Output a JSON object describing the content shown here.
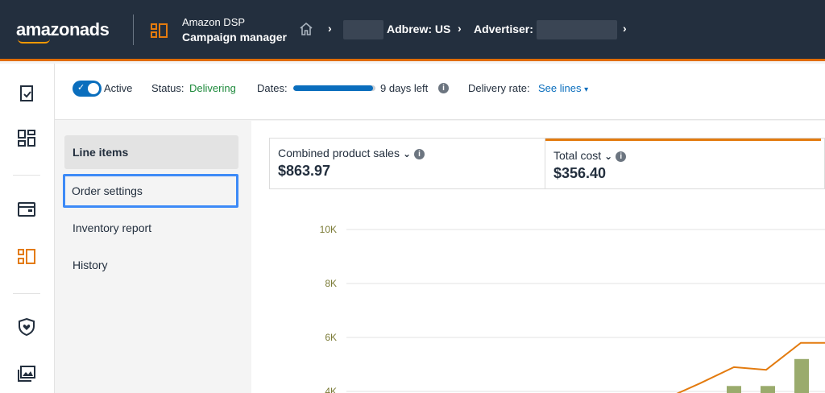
{
  "header": {
    "logo": "amazonads",
    "app_title": "Amazon DSP",
    "app_subtitle": "Campaign manager",
    "breadcrumb_account": "Adbrew: US",
    "breadcrumb_advertiser": "Advertiser:"
  },
  "status": {
    "active_label": "Active",
    "status_label": "Status:",
    "status_value": "Delivering",
    "dates_label": "Dates:",
    "dates_progress": 0.97,
    "days_left": "9 days left",
    "delivery_label": "Delivery rate:",
    "delivery_link": "See lines"
  },
  "subnav": {
    "items": [
      {
        "label": "Line items"
      },
      {
        "label": "Order settings"
      },
      {
        "label": "Inventory report"
      },
      {
        "label": "History"
      }
    ]
  },
  "metrics": [
    {
      "label": "Combined product sales",
      "value": "$863.97"
    },
    {
      "label": "Total cost",
      "value": "$356.40"
    }
  ],
  "colors": {
    "accent_orange": "#e37b0f",
    "bar_green": "#9aab6d",
    "link_blue": "#0a6ebd",
    "header_bg": "#232f3e"
  },
  "chart_data": {
    "type": "bar",
    "ytick_labels": [
      "10K",
      "8K",
      "6K",
      "4K"
    ],
    "ylim": [
      4000,
      10000
    ],
    "bars": [
      {
        "value": 4200
      },
      {
        "value": 4200
      },
      {
        "value": 5200
      },
      {
        "value": 4200
      }
    ],
    "line": [
      {
        "value": 3700
      },
      {
        "value": 4300
      },
      {
        "value": 4900
      },
      {
        "value": 4800
      },
      {
        "value": 5800
      },
      {
        "value": 5800
      }
    ]
  }
}
